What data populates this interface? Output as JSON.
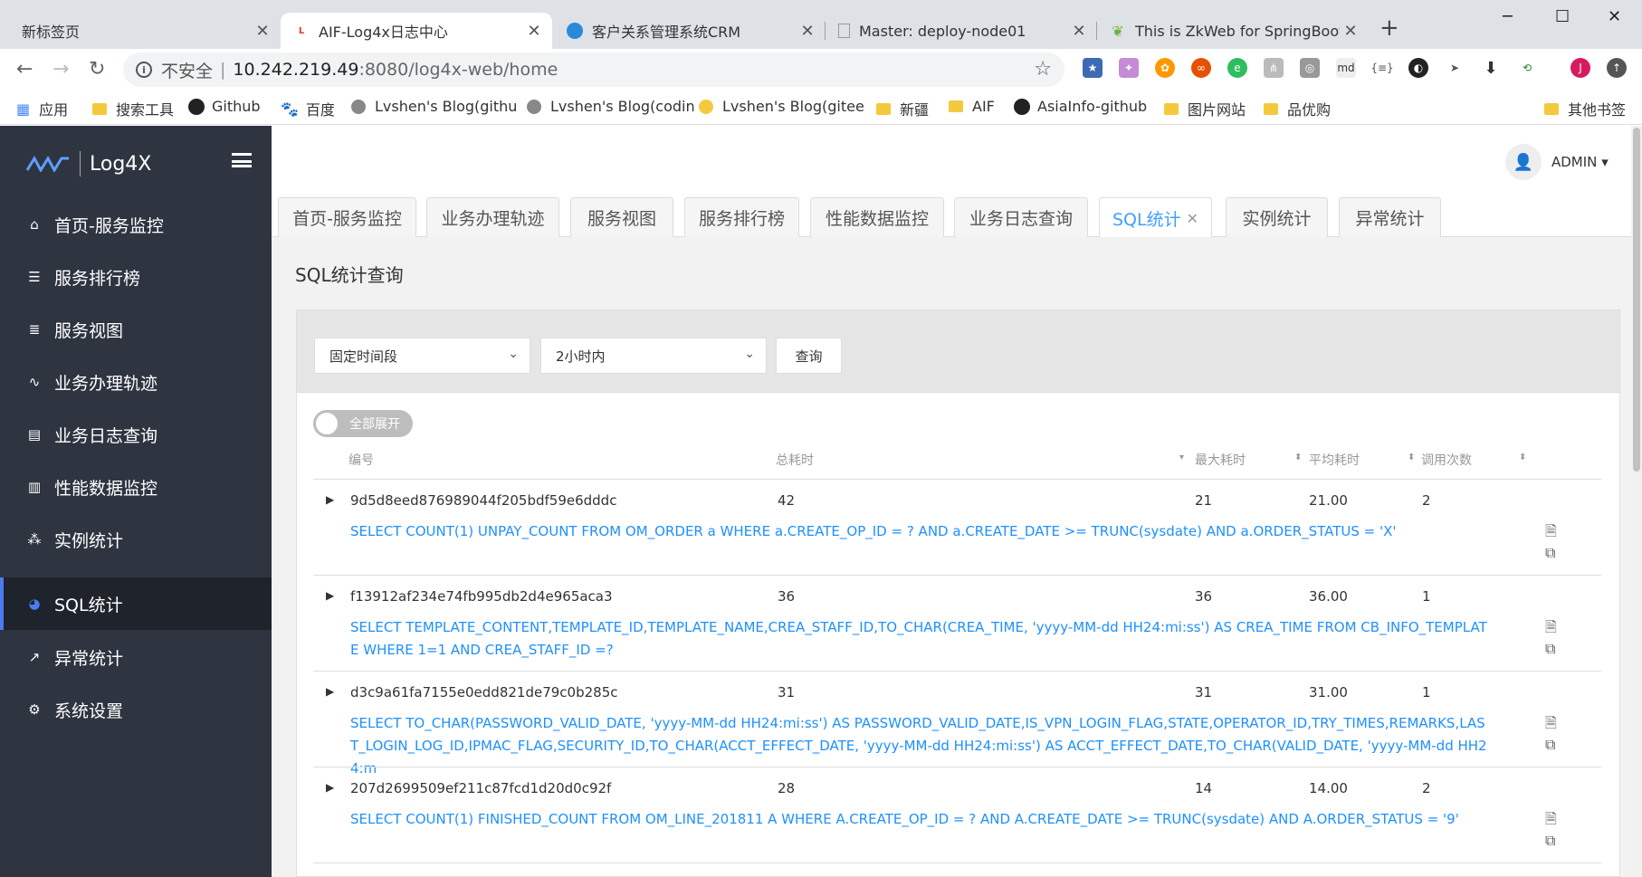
{
  "browser": {
    "tabs": [
      {
        "title": "新标签页",
        "active": false
      },
      {
        "title": "AIF-Log4x日志中心",
        "active": true
      },
      {
        "title": "客户关系管理系统CRM",
        "active": false
      },
      {
        "title": "Master: deploy-node01",
        "active": false
      },
      {
        "title": "This is ZkWeb for SpringBoot",
        "active": false
      }
    ],
    "url": {
      "security": "不安全",
      "host": "10.242.219.49",
      "path": ":8080/log4x-web/home"
    },
    "bookmarks": [
      "应用",
      "搜索工具",
      "Github",
      "百度",
      "Lvshen's Blog(githu",
      "Lvshen's Blog(codin",
      "Lvshen's Blog(gitee",
      "新疆",
      "AIF",
      "AsiaInfo-github",
      "图片网站",
      "品优购",
      "其他书签"
    ],
    "profile_initial": "J"
  },
  "app": {
    "logo_text": "Log4X",
    "user": "ADMIN",
    "menu": [
      {
        "label": "首页-服务监控",
        "icon": "home-icon"
      },
      {
        "label": "服务排行榜",
        "icon": "list-icon"
      },
      {
        "label": "服务视图",
        "icon": "server-icon"
      },
      {
        "label": "业务办理轨迹",
        "icon": "track-icon"
      },
      {
        "label": "业务日志查询",
        "icon": "log-icon"
      },
      {
        "label": "性能数据监控",
        "icon": "bar-chart-icon"
      },
      {
        "label": "实例统计",
        "icon": "cluster-icon"
      },
      {
        "label": "SQL统计",
        "icon": "pie-chart-icon",
        "active": true
      },
      {
        "label": "异常统计",
        "icon": "line-chart-icon"
      },
      {
        "label": "系统设置",
        "icon": "gear-icon"
      }
    ],
    "tabs": [
      "首页-服务监控",
      "业务办理轨迹",
      "服务视图",
      "服务排行榜",
      "性能数据监控",
      "业务日志查询",
      "SQL统计",
      "实例统计",
      "异常统计"
    ],
    "active_tab": "SQL统计",
    "page_title": "SQL统计查询",
    "filters": {
      "range_type": "固定时间段",
      "period": "2小时内",
      "query_button": "查询"
    },
    "toggle_label": "全部展开",
    "columns": {
      "id": "编号",
      "total": "总耗时",
      "max": "最大耗时",
      "avg": "平均耗时",
      "count": "调用次数"
    },
    "rows": [
      {
        "id": "9d5d8eed876989044f205bdf59e6dddc",
        "total": "42",
        "max": "21",
        "avg": "21.00",
        "count": "2",
        "sql": "SELECT COUNT(1) UNPAY_COUNT FROM OM_ORDER a WHERE a.CREATE_OP_ID = ? AND a.CREATE_DATE >= TRUNC(sysdate) AND a.ORDER_STATUS = 'X'"
      },
      {
        "id": "f13912af234e74fb995db2d4e965aca3",
        "total": "36",
        "max": "36",
        "avg": "36.00",
        "count": "1",
        "sql": "SELECT TEMPLATE_CONTENT,TEMPLATE_ID,TEMPLATE_NAME,CREA_STAFF_ID,TO_CHAR(CREA_TIME, 'yyyy-MM-dd HH24:mi:ss') AS CREA_TIME FROM CB_INFO_TEMPLATE WHERE 1=1 AND CREA_STAFF_ID =?"
      },
      {
        "id": "d3c9a61fa7155e0edd821de79c0b285c",
        "total": "31",
        "max": "31",
        "avg": "31.00",
        "count": "1",
        "sql": "SELECT TO_CHAR(PASSWORD_VALID_DATE, 'yyyy-MM-dd HH24:mi:ss') AS PASSWORD_VALID_DATE,IS_VPN_LOGIN_FLAG,STATE,OPERATOR_ID,TRY_TIMES,REMARKS,LAST_LOGIN_LOG_ID,IPMAC_FLAG,SECURITY_ID,TO_CHAR(ACCT_EFFECT_DATE, 'yyyy-MM-dd HH24:mi:ss') AS ACCT_EFFECT_DATE,TO_CHAR(VALID_DATE, 'yyyy-MM-dd HH24:m"
      },
      {
        "id": "207d2699509ef211c87fcd1d20d0c92f",
        "total": "28",
        "max": "14",
        "avg": "14.00",
        "count": "2",
        "sql": "SELECT COUNT(1) FINISHED_COUNT FROM OM_LINE_201811 A WHERE A.CREATE_OP_ID = ? AND A.CREATE_DATE >= TRUNC(sysdate) AND A.ORDER_STATUS = '9'"
      }
    ]
  },
  "colors": {
    "sidebar": "#2e3440",
    "accent": "#409eff",
    "sql_text": "#1e90ff",
    "active_bar": "#4a7cf0"
  }
}
